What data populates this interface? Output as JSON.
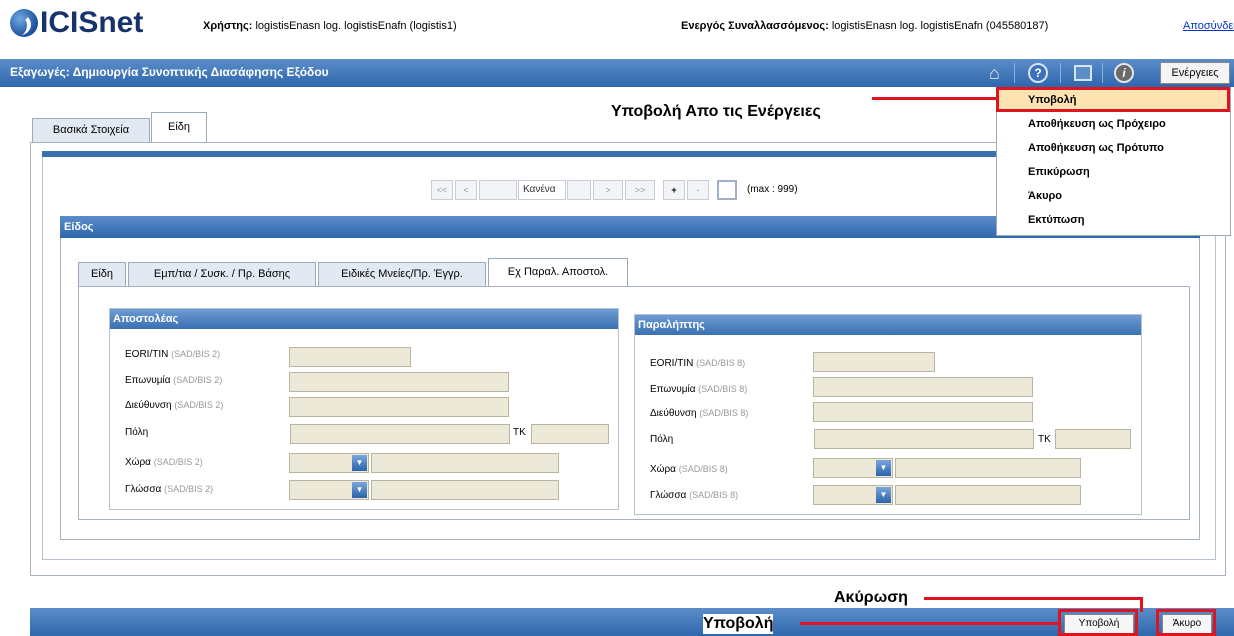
{
  "app": {
    "logo_text": "ICISnet",
    "user_label": "Χρήστης:",
    "user_value": "logistisEnasn log. logistisEnafn (logistis1)",
    "trader_label": "Ενεργός Συναλλασσόμενος:",
    "trader_value": "logistisEnasn log. logistisEnafn (045580187)",
    "logout": "Αποσύνδεση"
  },
  "titlebar": {
    "title": "Εξαγωγές: Δημιουργία Συνοπτικής Διασάφησης Εξόδου",
    "actions": "Ενέργειες"
  },
  "tabs": [
    "Βασικά Στοιχεία",
    "Είδη"
  ],
  "pager": {
    "first": "<<",
    "prev": "<",
    "current": "Κανένα",
    "next": ">",
    "last": ">>",
    "add": "+",
    "remove": "-",
    "max": "(max : 999)"
  },
  "item_section": {
    "title": "Είδος",
    "subtabs": [
      "Είδη",
      "Εμπ/τια / Συσκ. / Πρ. Βάσης",
      "Ειδικές Μνείες/Πρ. Έγγρ.",
      "Εχ Παραλ. Αποστολ."
    ]
  },
  "consignor": {
    "title": "Αποστολέας",
    "eori": "EORI/TIN",
    "name": "Επωνυμία",
    "address": "Διεύθυνση",
    "city": "Πόλη",
    "zip": "ΤΚ",
    "country": "Χώρα",
    "language": "Γλώσσα",
    "ref": "(SAD/BIS 2)"
  },
  "consignee": {
    "title": "Παραλήπτης",
    "eori": "EORI/TIN",
    "name": "Επωνυμία",
    "address": "Διεύθυνση",
    "city": "Πόλη",
    "zip": "ΤΚ",
    "country": "Χώρα",
    "language": "Γλώσσα",
    "ref": "(SAD/BIS 8)"
  },
  "menu": {
    "items": [
      "Υποβολή",
      "Αποθήκευση ως Πρόχειρο",
      "Αποθήκευση ως Πρότυπο",
      "Επικύρωση",
      "Άκυρο",
      "Εκτύπωση"
    ]
  },
  "bottom": {
    "submit": "Υποβολή",
    "cancel": "Άκυρο"
  },
  "annotations": {
    "menu_submit": "Υποβολή Απο τις Ενέργειες",
    "cancel": "Ακύρωση",
    "submit": "Υποβολή"
  },
  "colors": {
    "titlebar": "#2e67ad",
    "highlight": "#ffe3b3",
    "annotation": "#e0141e"
  }
}
